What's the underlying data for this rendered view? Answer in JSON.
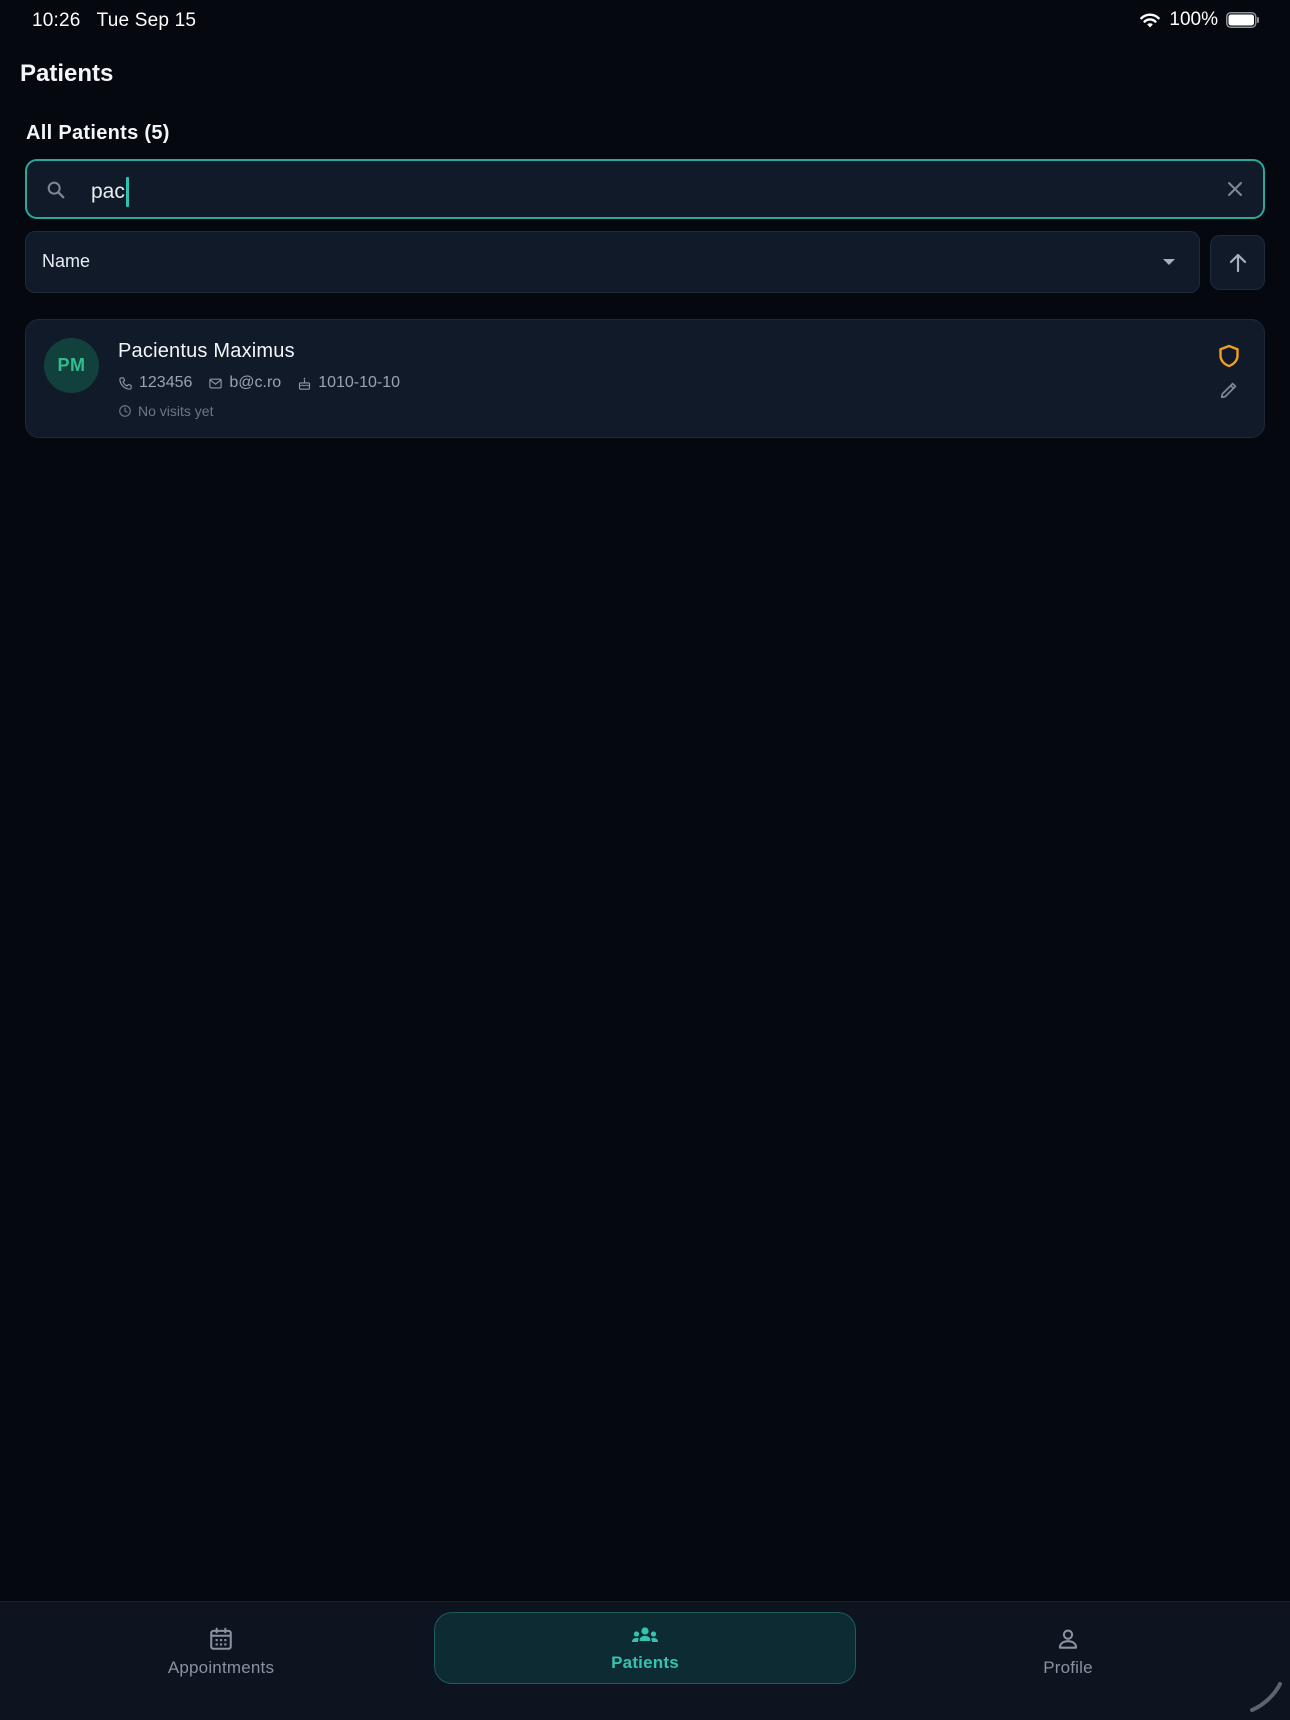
{
  "status_bar": {
    "time": "10:26",
    "date": "Tue Sep 15",
    "battery_percent": "100%",
    "icons": [
      "wifi-icon",
      "battery-icon"
    ]
  },
  "page": {
    "title": "Patients"
  },
  "list": {
    "section_title": "All Patients (5)"
  },
  "search": {
    "value": "pac",
    "icon": "search-icon",
    "clear_icon": "close-icon"
  },
  "sort": {
    "selected": "Name",
    "direction_icon": "arrow-up-icon"
  },
  "patients": [
    {
      "initials": "PM",
      "name": "Pacientus Maximus",
      "phone": "123456",
      "email": "b@c.ro",
      "birthdate": "1010-10-10",
      "last_visit": "No visits yet",
      "badge_icon": "shield-icon",
      "action_icon": "edit-icon"
    }
  ],
  "nav": {
    "items": [
      {
        "label": "Appointments",
        "icon": "calendar-icon",
        "active": false
      },
      {
        "label": "Patients",
        "icon": "people-icon",
        "active": true
      },
      {
        "label": "Profile",
        "icon": "person-icon",
        "active": false
      }
    ]
  },
  "colors": {
    "background": "#05080f",
    "surface": "#111a28",
    "accent": "#2aa89a",
    "avatar_bg": "#12413d",
    "avatar_text": "#2fbf8f",
    "shield": "#f0a020",
    "nav_active_bg": "#0d2b33"
  }
}
